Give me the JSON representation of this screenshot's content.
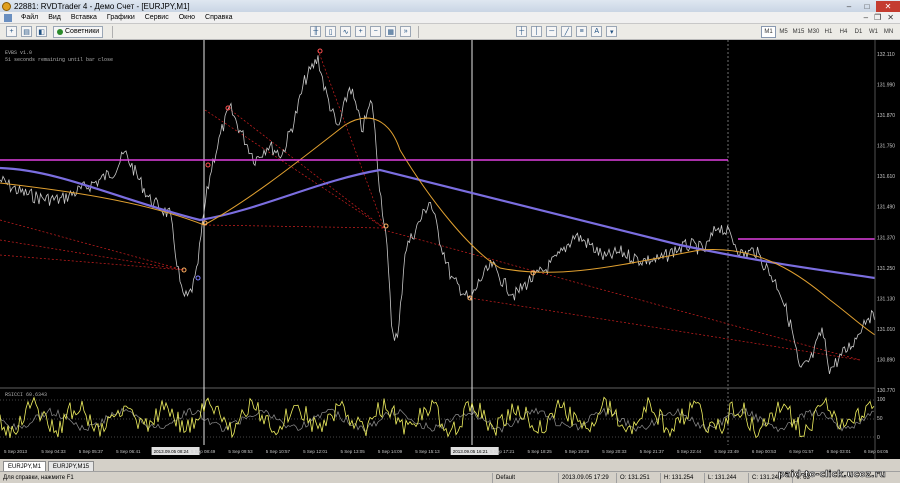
{
  "window": {
    "title": "22881: RVDTrader 4 - Демо Счет - [EURJPY,M1]"
  },
  "menu": [
    "Файл",
    "Вид",
    "Вставка",
    "Графики",
    "Сервис",
    "Окно",
    "Справка"
  ],
  "toolbar": {
    "experts_label": "Советники"
  },
  "timeframes": [
    {
      "label": "M1",
      "active": true
    },
    {
      "label": "M5",
      "active": false
    },
    {
      "label": "M15",
      "active": false
    },
    {
      "label": "M30",
      "active": false
    },
    {
      "label": "H1",
      "active": false
    },
    {
      "label": "H4",
      "active": false
    },
    {
      "label": "D1",
      "active": false
    },
    {
      "label": "W1",
      "active": false
    },
    {
      "label": "MN",
      "active": false
    }
  ],
  "chart_info": {
    "line1": "EVBS v1.0",
    "line2": "51 seconds remaining until bar close"
  },
  "indicator_label": "RSICCI 60.6343",
  "chart_data": {
    "type": "line",
    "symbol": "EURJPY,M1",
    "y_ticks": [
      "132.110",
      "131.990",
      "131.870",
      "131.750",
      "131.610",
      "131.490",
      "131.370",
      "131.250",
      "131.130",
      "131.010",
      "130.890",
      "130.770"
    ],
    "x_ticks": [
      "5 Sep 2013",
      "5 Sep 04:33",
      "5 Sep 05:37",
      "5 Sep 06:41",
      "2013.09.05 08:24",
      "5 Sep 08:49",
      "5 Sep 09:53",
      "5 Sep 10:57",
      "5 Sep 12:01",
      "5 Sep 13:05",
      "5 Sep 14:09",
      "5 Sep 15:13",
      "2013.09.05 16:21",
      "5 Sep 17:21",
      "5 Sep 18:25",
      "5 Sep 19:29",
      "5 Sep 20:33",
      "5 Sep 21:37",
      "5 Sep 22:44",
      "5 Sep 23:49",
      "6 Sep 00:53",
      "6 Sep 01:57",
      "6 Sep 03:01",
      "6 Sep 04:05"
    ],
    "indicator_ticks": [
      "100",
      "50",
      "0"
    ],
    "colors": {
      "price": "#c8c8c8",
      "ma_slow": "#7b6ee0",
      "ma_fast": "#e0a030",
      "level": "#e040e0",
      "fan": "#d02020",
      "rsi": "#f0f060"
    }
  },
  "tabs": [
    {
      "label": "EURJPY,M1",
      "active": true
    },
    {
      "label": "EURJPY,M15",
      "active": false
    }
  ],
  "status": {
    "help": "Для справки, нажмите F1",
    "profile": "Default",
    "datetime": "2013.09.05 17:29",
    "open": "O: 131.251",
    "high": "H: 131.254",
    "low": "L: 131.244",
    "close": "C: 131.246",
    "volume": "V: 63"
  },
  "watermark": "paid-to-click.ucoz.ru"
}
